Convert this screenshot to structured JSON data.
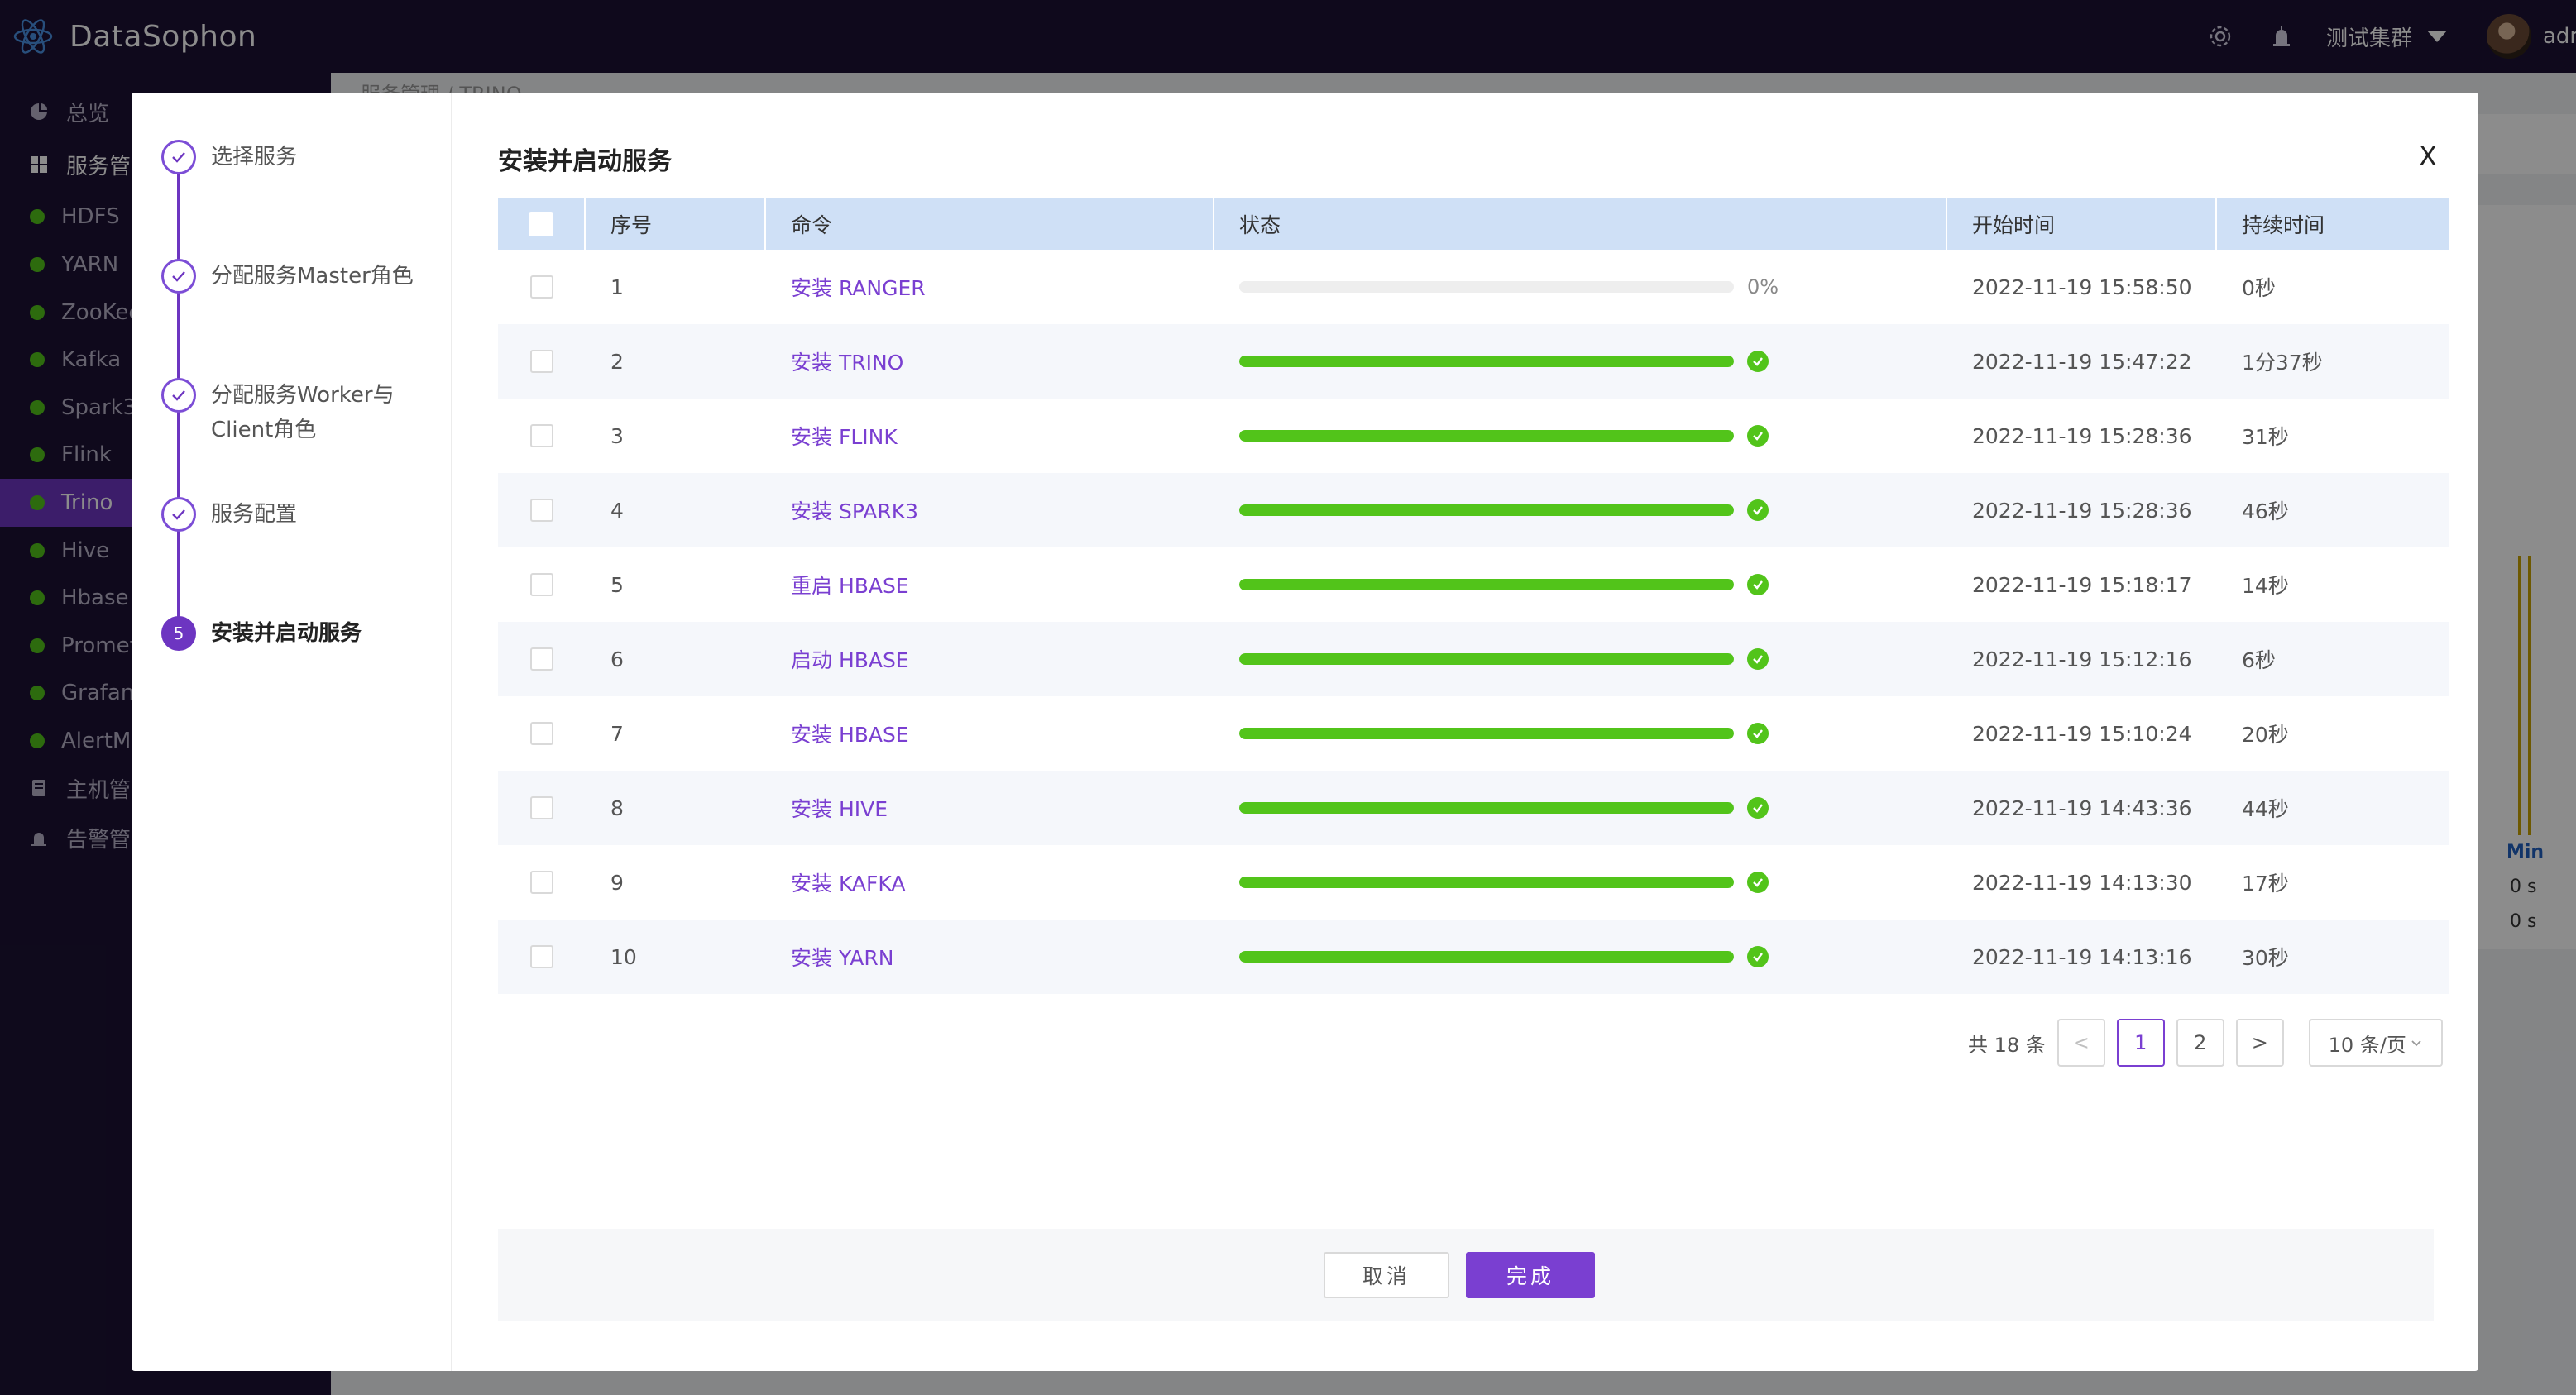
{
  "app": {
    "name": "DataSophon",
    "cluster": "测试集群",
    "user": "adr"
  },
  "breadcrumb": "服务管理 / TRINO",
  "sidebar": {
    "items": [
      {
        "label": "总览",
        "type": "menu",
        "icon": "pie-chart-icon"
      },
      {
        "label": "服务管",
        "type": "menu",
        "icon": "grid-icon"
      },
      {
        "label": "HDFS",
        "type": "service"
      },
      {
        "label": "YARN",
        "type": "service"
      },
      {
        "label": "ZooKee",
        "type": "service"
      },
      {
        "label": "Kafka",
        "type": "service"
      },
      {
        "label": "Spark3",
        "type": "service"
      },
      {
        "label": "Flink",
        "type": "service"
      },
      {
        "label": "Trino",
        "type": "service",
        "active": true
      },
      {
        "label": "Hive",
        "type": "service"
      },
      {
        "label": "Hbase",
        "type": "service"
      },
      {
        "label": "Promet",
        "type": "service"
      },
      {
        "label": "Grafana",
        "type": "service"
      },
      {
        "label": "AlertMa",
        "type": "service"
      },
      {
        "label": "主机管",
        "type": "menu",
        "icon": "server-icon"
      },
      {
        "label": "告警管",
        "type": "menu",
        "icon": "alarm-icon"
      }
    ]
  },
  "background": {
    "min_label": "Min",
    "vals": [
      "0 s",
      "0 s"
    ]
  },
  "modal": {
    "title": "安装并启动服务",
    "close": "X",
    "steps": [
      {
        "label": "选择服务",
        "state": "done"
      },
      {
        "label": "分配服务Master角色",
        "state": "done"
      },
      {
        "label": "分配服务Worker与Client角色",
        "state": "done"
      },
      {
        "label": "服务配置",
        "state": "done"
      },
      {
        "label": "安装并启动服务",
        "state": "current",
        "number": "5"
      }
    ],
    "table": {
      "headers": [
        "序号",
        "命令",
        "状态",
        "开始时间",
        "持续时间"
      ],
      "rows": [
        {
          "no": "1",
          "cmd": "安装 RANGER",
          "progress": 0,
          "pct": "0%",
          "start": "2022-11-19 15:58:50",
          "dur": "0秒"
        },
        {
          "no": "2",
          "cmd": "安装 TRINO",
          "progress": 100,
          "start": "2022-11-19 15:47:22",
          "dur": "1分37秒"
        },
        {
          "no": "3",
          "cmd": "安装 FLINK",
          "progress": 100,
          "start": "2022-11-19 15:28:36",
          "dur": "31秒"
        },
        {
          "no": "4",
          "cmd": "安装 SPARK3",
          "progress": 100,
          "start": "2022-11-19 15:28:36",
          "dur": "46秒"
        },
        {
          "no": "5",
          "cmd": "重启 HBASE",
          "progress": 100,
          "start": "2022-11-19 15:18:17",
          "dur": "14秒"
        },
        {
          "no": "6",
          "cmd": "启动 HBASE",
          "progress": 100,
          "start": "2022-11-19 15:12:16",
          "dur": "6秒"
        },
        {
          "no": "7",
          "cmd": "安装 HBASE",
          "progress": 100,
          "start": "2022-11-19 15:10:24",
          "dur": "20秒"
        },
        {
          "no": "8",
          "cmd": "安装 HIVE",
          "progress": 100,
          "start": "2022-11-19 14:43:36",
          "dur": "44秒"
        },
        {
          "no": "9",
          "cmd": "安装 KAFKA",
          "progress": 100,
          "start": "2022-11-19 14:13:30",
          "dur": "17秒"
        },
        {
          "no": "10",
          "cmd": "安装 YARN",
          "progress": 100,
          "start": "2022-11-19 14:13:16",
          "dur": "30秒"
        }
      ]
    },
    "pagination": {
      "total": "共 18 条",
      "prev": "<",
      "pages": [
        "1",
        "2"
      ],
      "current": "1",
      "next": ">",
      "page_size": "10 条/页"
    },
    "buttons": {
      "cancel": "取消",
      "finish": "完成"
    }
  },
  "colors": {
    "brand": "#6d35c1",
    "topbar": "#1c1233",
    "success": "#52c41a",
    "header_row": "#cfe0f6"
  }
}
